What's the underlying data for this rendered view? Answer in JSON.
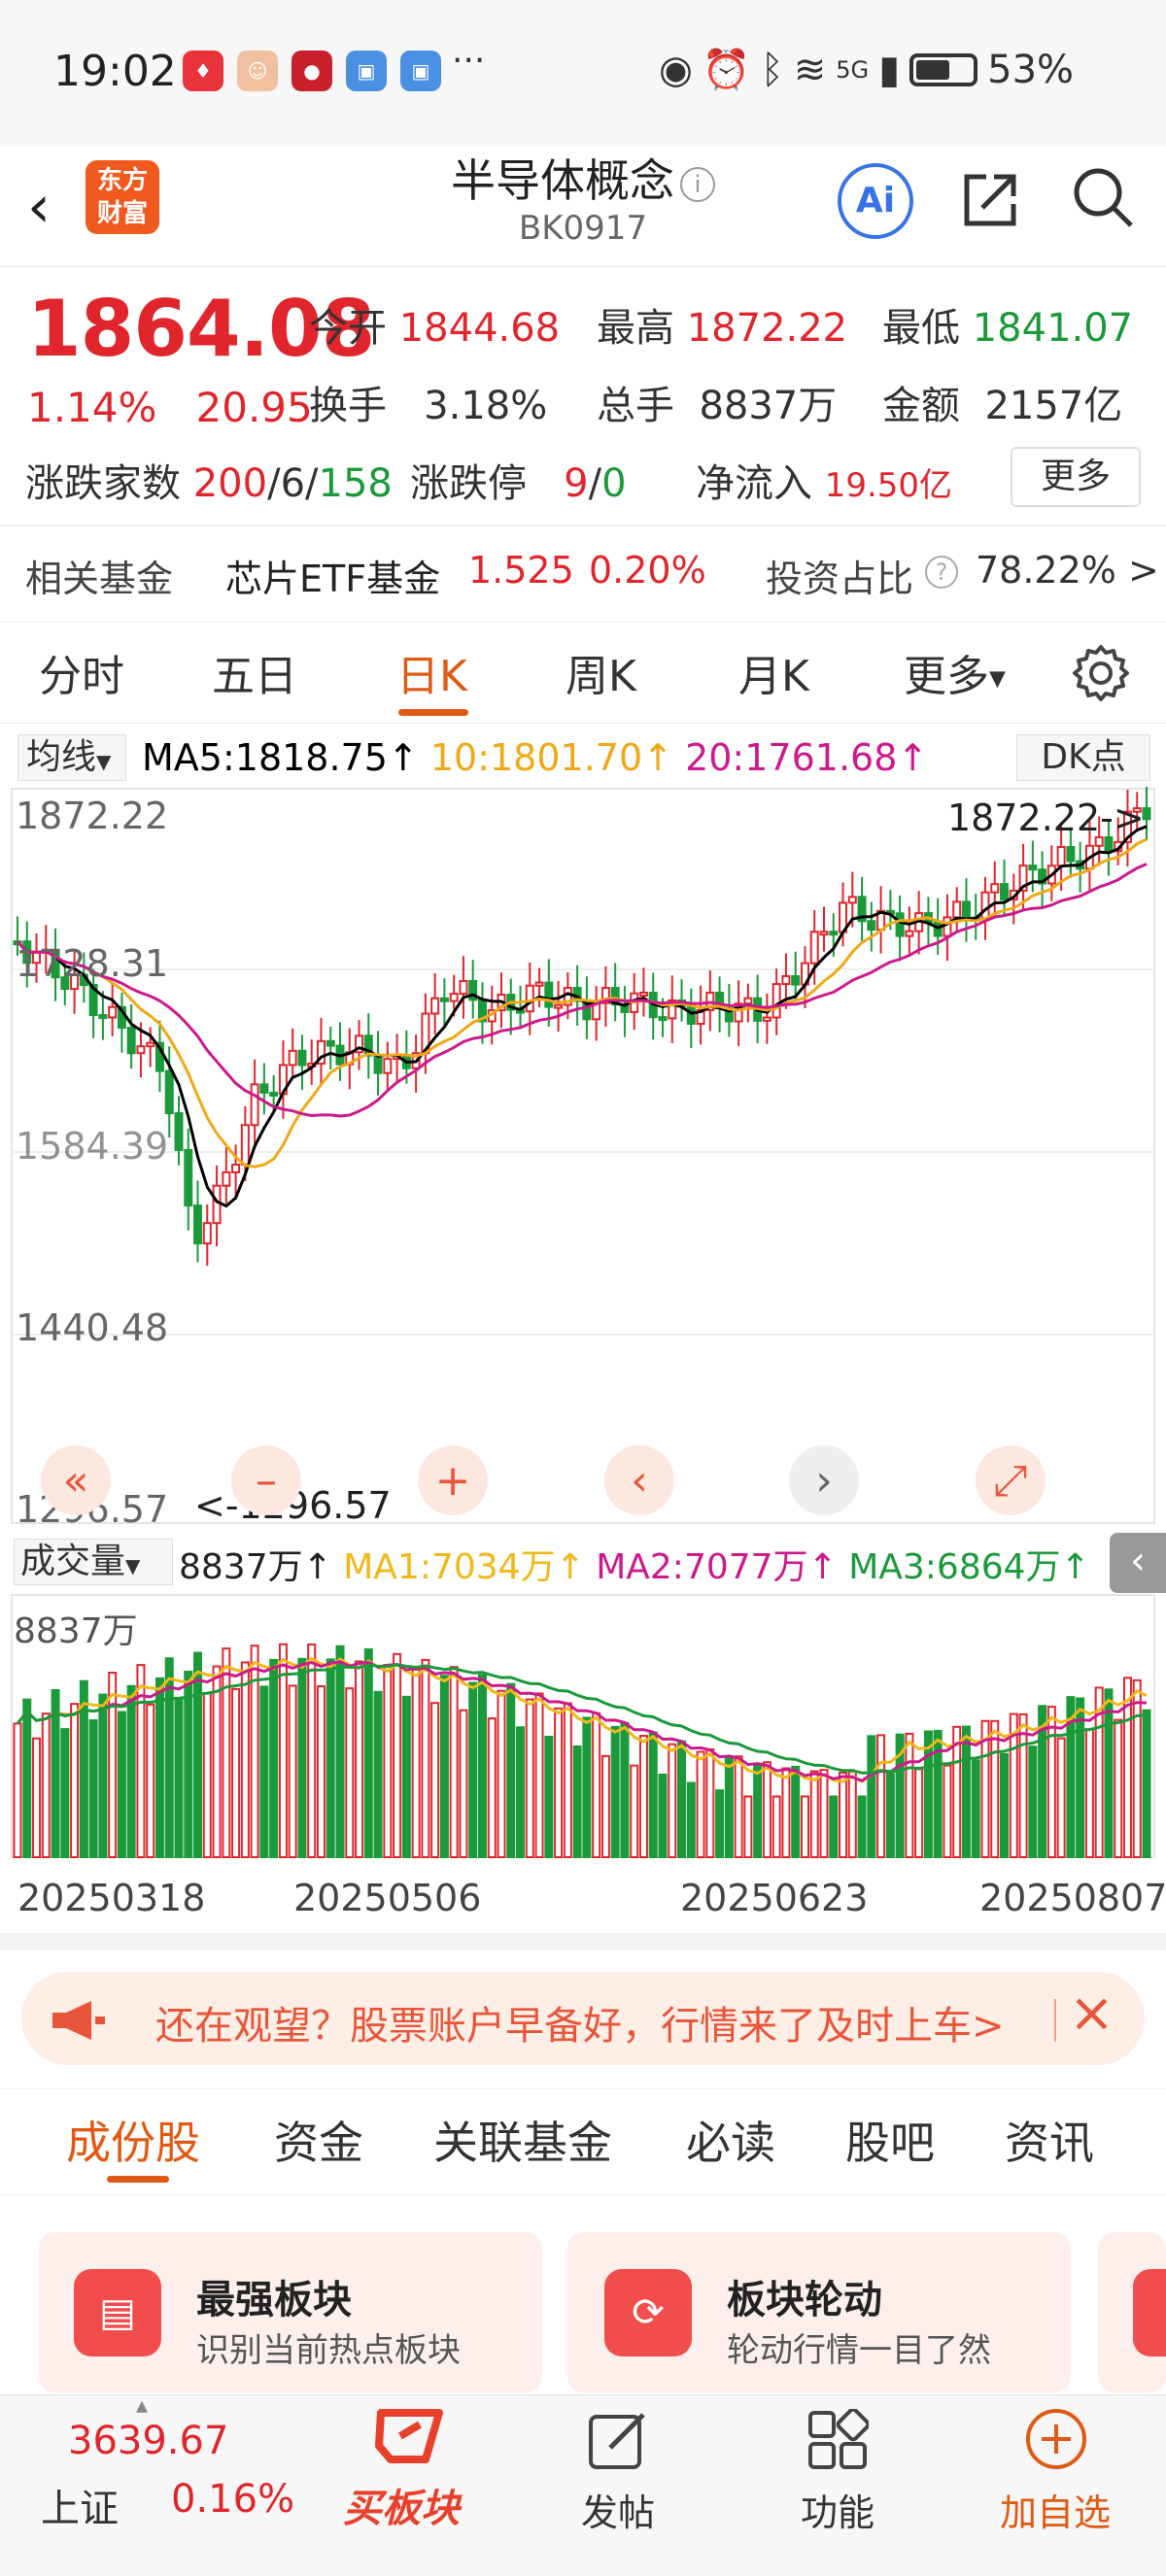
{
  "status_bar": {
    "time": "19:02",
    "dots": "···",
    "network": "5G",
    "battery": "53%"
  },
  "header": {
    "logo_line1": "东方",
    "logo_line2": "财富",
    "title": "半导体概念",
    "code": "BK0917",
    "ai_label": "Ai"
  },
  "quote": {
    "price": "1864.08",
    "change_pct": "1.14%",
    "change_abs": "20.95",
    "open_label": "今开",
    "open": "1844.68",
    "high_label": "最高",
    "high": "1872.22",
    "low_label": "最低",
    "low": "1841.07",
    "turnover_label": "换手",
    "turnover": "3.18%",
    "volume_label": "总手",
    "volume": "8837万",
    "amount_label": "金额",
    "amount": "2157亿",
    "breadth_label": "涨跌家数",
    "up": "200",
    "flat": "6",
    "down": "158",
    "limit_label": "涨跌停",
    "limit_up": "9",
    "limit_down": "0",
    "inflow_label": "净流入",
    "inflow": "19.50亿",
    "more": "更多"
  },
  "fund_row": {
    "label": "相关基金",
    "fund_name": "芯片ETF基金",
    "fund_price": "1.525",
    "fund_pct": "0.20%",
    "ratio_label": "投资占比",
    "ratio": "78.22% >"
  },
  "chart_tabs": [
    {
      "label": "分时"
    },
    {
      "label": "五日"
    },
    {
      "label": "日K"
    },
    {
      "label": "周K"
    },
    {
      "label": "月K"
    },
    {
      "label": "更多"
    }
  ],
  "ma_row": {
    "selector": "均线",
    "ma5": "MA5:1818.75↑",
    "ma10": "10:1801.70↑",
    "ma20": "20:1761.68↑",
    "dk": "DK点"
  },
  "kline": {
    "y_labels": [
      "1872.22",
      "1728.31",
      "1584.39",
      "1440.48",
      "1296.57"
    ],
    "max_marker": "1872.22->",
    "min_marker": "<-1296.57",
    "nav": [
      "«",
      "–",
      "+",
      "‹",
      "›",
      "⤢"
    ]
  },
  "volume_row": {
    "selector": "成交量",
    "vol": "8837万↑",
    "ma1": "MA1:7034万↑",
    "ma2": "MA2:7077万↑",
    "ma3": "MA3:6864万↑",
    "axis_label": "8837万"
  },
  "x_axis": [
    "20250318",
    "20250506",
    "20250623",
    "20250807"
  ],
  "ad": {
    "text": "还在观望？股票账户早备好，行情来了及时上车>",
    "close": "×"
  },
  "sub_tabs": [
    {
      "label": "成份股"
    },
    {
      "label": "资金"
    },
    {
      "label": "关联基金"
    },
    {
      "label": "必读"
    },
    {
      "label": "股吧"
    },
    {
      "label": "资讯"
    }
  ],
  "cards": [
    {
      "title": "最强板块",
      "sub": "识别当前热点板块"
    },
    {
      "title": "板块轮动",
      "sub": "轮动行情一目了然"
    }
  ],
  "bottom_bar": {
    "index_value": "3639.67",
    "index_name": "上证",
    "index_pct": "0.16%",
    "buy_label": "买板块",
    "post_label": "发帖",
    "func_label": "功能",
    "add_label": "加自选"
  },
  "colors": {
    "up": "#e0262c",
    "down": "#1a9a3a",
    "accent": "#e05a14",
    "ma5": "#000000",
    "ma10": "#f0a818",
    "ma20": "#cc1a8c"
  }
}
